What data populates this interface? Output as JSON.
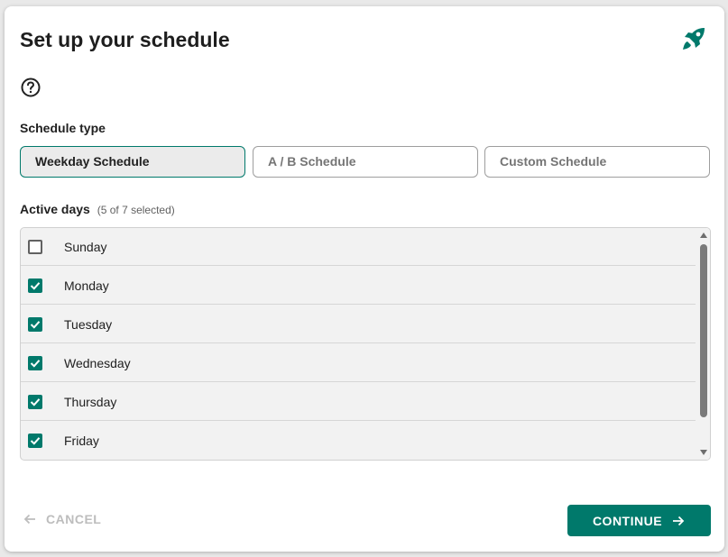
{
  "dialog": {
    "title": "Set up your schedule",
    "header_icon": "rocket-icon",
    "help_icon": "help-circle-icon"
  },
  "schedule_type": {
    "label": "Schedule type",
    "options": [
      {
        "label": "Weekday Schedule",
        "selected": true
      },
      {
        "label": "A / B Schedule",
        "selected": false
      },
      {
        "label": "Custom Schedule",
        "selected": false
      }
    ]
  },
  "active_days": {
    "label": "Active days",
    "count_text": "(5 of 7 selected)",
    "days": [
      {
        "name": "Sunday",
        "checked": false
      },
      {
        "name": "Monday",
        "checked": true
      },
      {
        "name": "Tuesday",
        "checked": true
      },
      {
        "name": "Wednesday",
        "checked": true
      },
      {
        "name": "Thursday",
        "checked": true
      },
      {
        "name": "Friday",
        "checked": true
      }
    ]
  },
  "footer": {
    "cancel_label": "CANCEL",
    "continue_label": "CONTINUE"
  },
  "colors": {
    "accent": "#00796b",
    "disabled_text": "#bdbdbd"
  }
}
